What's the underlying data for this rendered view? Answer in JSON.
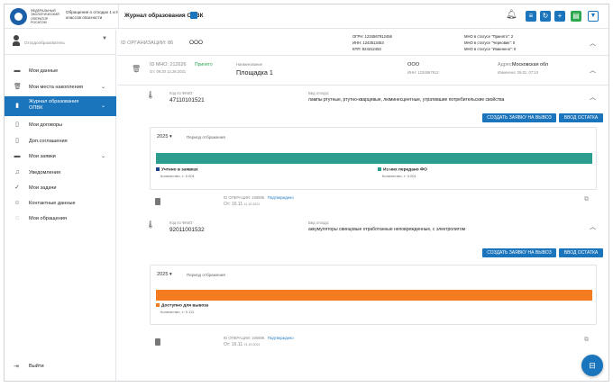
{
  "header": {
    "logo_text": "ФЕДЕРАЛЬНЫЙ ЭКОЛОГИЧЕСКИЙ ОПЕРАТОР РОСАТОМ",
    "notice": "Обращение о отходах 1 и II классов опасности",
    "title": "Журнал образования ОПВК",
    "actions": [
      "bell",
      "list",
      "refresh",
      "add",
      "export",
      "filter"
    ]
  },
  "sidebar": {
    "user_name": "Отходообразователь",
    "items": [
      {
        "label": "Мои данные",
        "icon": "folder-icon",
        "has_chevron": false,
        "active": false
      },
      {
        "label": "Мои места накопления",
        "icon": "trash-icon",
        "has_chevron": true,
        "active": false
      },
      {
        "label": "Журнал образования ОПВК",
        "icon": "journal-icon",
        "has_chevron": true,
        "active": true
      },
      {
        "label": "Мои договоры",
        "icon": "document-icon",
        "has_chevron": false,
        "active": false
      },
      {
        "label": "Доп.соглашения",
        "icon": "document-icon",
        "has_chevron": false,
        "active": false
      },
      {
        "label": "Мои заявки",
        "icon": "folder-icon",
        "has_chevron": true,
        "active": false
      },
      {
        "label": "Уведомления",
        "icon": "bell-icon",
        "has_chevron": false,
        "active": false
      },
      {
        "label": "Мои задачи",
        "icon": "check-icon",
        "has_chevron": false,
        "active": false
      },
      {
        "label": "Контактные данные",
        "icon": "contacts-icon",
        "has_chevron": false,
        "active": false
      },
      {
        "label": "Мои обращения",
        "icon": "chat-icon",
        "has_chevron": false,
        "active": false
      }
    ],
    "logout": "Выйти"
  },
  "org": {
    "id_label": "ID ОРГАНИЗАЦИИ: 86",
    "name": "ООО",
    "ogrn": "ОГРН: 1234567912456",
    "inn": "ИНН: 1243513453",
    "kpp": "КПП: 824312453",
    "mno_accepted": "МНО в статусе \"Принято\": 2",
    "mno_draft": "МНО в статусе \"Черновик\": 0",
    "mno_changed": "МНО в статусе \"Изменено\": 0"
  },
  "point": {
    "id_label": "ID МНО: 212626",
    "status": "Принято",
    "date_label": "От: 09.20 12.28.2021",
    "name_label": "Наименование",
    "name": "Площадка 1",
    "org_name": "ООО",
    "org_inn": "ИНН: 1234567912",
    "address_label": "Адрес:",
    "address": "Московская обл",
    "changed_label": "Изменено: 26.01. 07:10"
  },
  "wastes": [
    {
      "fkko_label": "Код по ФККО:",
      "fkko": "47110101521",
      "kind_label": "Вид отхода:",
      "kind": "лампы ртутные, ртутно-кварцевые, люминесцентные, утратившие потребительские свойства",
      "year": "2025",
      "order_label": "Период отбражения",
      "bar_color": "#2a9d8f",
      "legend_left": "Учтено в заявках",
      "legend_left_qty": "Количество, т: 0.001",
      "legend_left_color": "#1b3f8f",
      "legend_right": "Из них передано ФО",
      "legend_right_qty": "Количество, т: 0.001",
      "legend_right_color": "#2a9d8f",
      "op_label": "ID ОПЕРАЦИИ: 190888.",
      "op_status": "Подтверждено",
      "op_date": "От: 16.11",
      "op_date_small": "11.10.2021"
    },
    {
      "fkko_label": "Код по ФККО:",
      "fkko": "92011001532",
      "kind_label": "Вид отхода:",
      "kind": "аккумуляторы свинцовые отработанные неповрежденные, с электролитом",
      "year": "2025",
      "order_label": "Период отбражения",
      "bar_color": "#f47b20",
      "legend_left": "Доступно для вывоза",
      "legend_left_qty": "Количество, т: 0.111",
      "legend_left_color": "#f47b20",
      "op_label": "ID ОПЕРАЦИИ: 190889.",
      "op_status": "Подтверждено",
      "op_date": "От: 16.11",
      "op_date_small": "21.10.2021"
    }
  ],
  "buttons": {
    "create_request": "СОЗДАТЬ ЗАЯВКУ НА ВЫВОЗ",
    "enter_balance": "ВВОД ОСТАТКА"
  },
  "colors": {
    "accent": "#1b75bc",
    "teal": "#2a9d8f",
    "orange": "#f47b20",
    "navy": "#1b3f8f",
    "green": "#2ca84f"
  }
}
